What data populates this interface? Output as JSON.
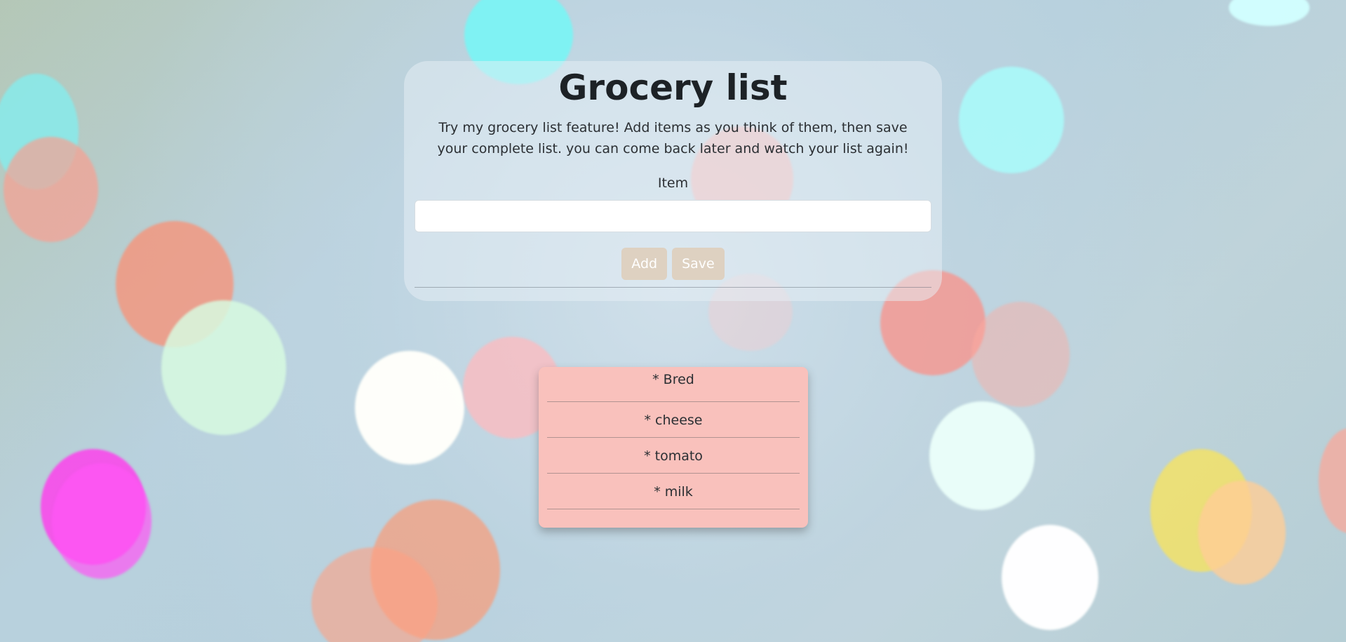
{
  "page": {
    "title": "Grocery list",
    "description": "Try my grocery list feature! Add items as you think of them, then save your complete list. you can come back later and watch your list again!"
  },
  "form": {
    "item_label": "Item",
    "item_value": "",
    "item_placeholder": "",
    "add_label": "Add",
    "save_label": "Save"
  },
  "list": {
    "items": [
      "* Bred",
      "* cheese",
      "* tomato",
      "* milk"
    ]
  },
  "colors": {
    "panel_background": "#e8f0f5",
    "list_background": "#f9c1bc",
    "button_background": "#decdb9",
    "button_text": "#ffffff"
  }
}
